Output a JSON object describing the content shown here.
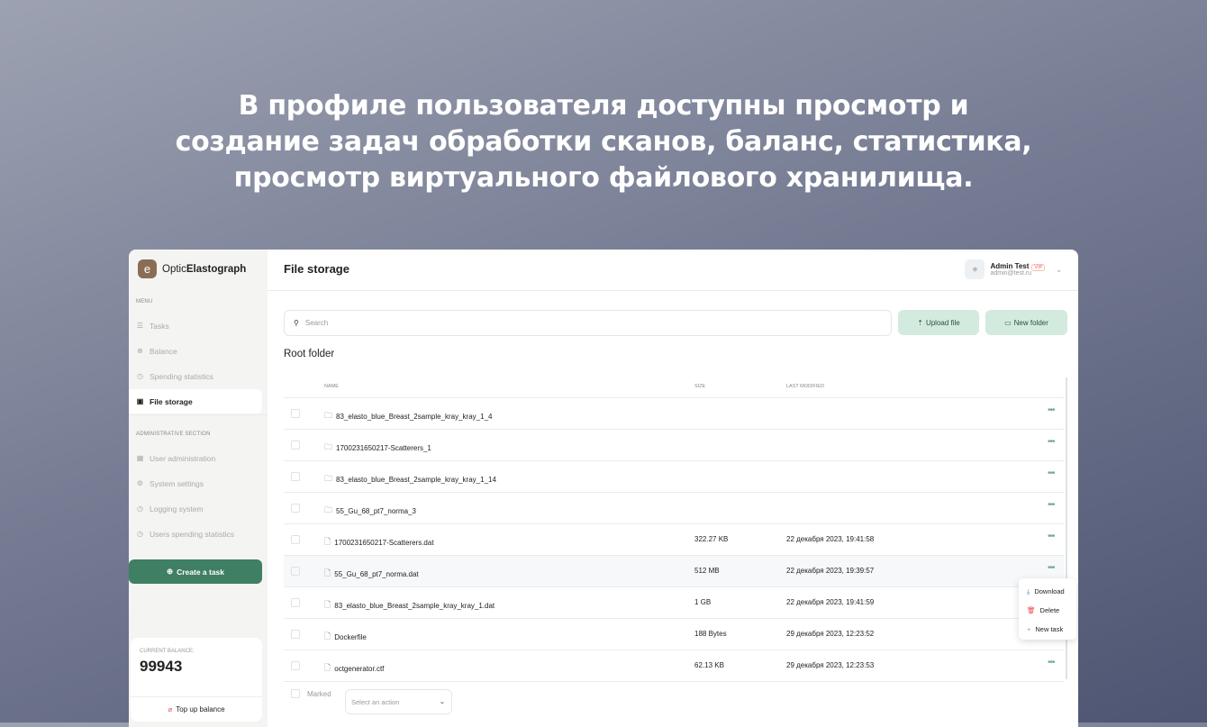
{
  "headline": [
    "В профиле пользователя доступны просмотр и",
    "создание задач обработки сканов, баланс, статистика,",
    "просмотр виртуального файлового хранилища."
  ],
  "app": {
    "logo_letter": "e",
    "name_light": "Optic",
    "name_bold": "Elastograph"
  },
  "sidebar": {
    "menu_label": "MENU",
    "items": [
      {
        "label": "Tasks",
        "icon": "☰"
      },
      {
        "label": "Balance",
        "icon": "⊗"
      },
      {
        "label": "Spending statistics",
        "icon": "◷"
      },
      {
        "label": "File storage",
        "icon": "▣"
      }
    ],
    "admin_label": "ADMINISTRATIVE SECTION",
    "admin_items": [
      {
        "label": "User administration",
        "icon": "▦"
      },
      {
        "label": "System settings",
        "icon": "⚙"
      },
      {
        "label": "Logging system",
        "icon": "◷"
      },
      {
        "label": "Users spending statistics",
        "icon": "◷"
      }
    ],
    "create_task": "Create a task",
    "balance_label": "CURRENT BALANCE:",
    "balance": "99943",
    "top_up": "Top up balance"
  },
  "header": {
    "title": "File storage",
    "user_name": "Admin Test",
    "badge": "VIP",
    "email": "admin@test.ru"
  },
  "toolbar": {
    "search_placeholder": "Search",
    "upload": "Upload file",
    "new_folder": "New folder"
  },
  "folder_title": "Root folder",
  "table": {
    "columns": [
      "NAME",
      "SIZE",
      "LAST MODIFIED"
    ],
    "rows": [
      {
        "type": "folder",
        "name": "83_elasto_blue_Breast_2sample_kray_kray_1_4",
        "size": "",
        "modified": ""
      },
      {
        "type": "folder",
        "name": "1700231650217-Scatterers_1",
        "size": "",
        "modified": ""
      },
      {
        "type": "folder",
        "name": "83_elasto_blue_Breast_2sample_kray_kray_1_14",
        "size": "",
        "modified": ""
      },
      {
        "type": "folder",
        "name": "55_Gu_68_pt7_norma_3",
        "size": "",
        "modified": ""
      },
      {
        "type": "file",
        "name": "1700231650217-Scatterers.dat",
        "size": "322.27 KB",
        "modified": "22 декабря 2023, 19:41:58"
      },
      {
        "type": "file",
        "name": "55_Gu_68_pt7_norma.dat",
        "size": "512 MB",
        "modified": "22 декабря 2023, 19:39:57"
      },
      {
        "type": "file",
        "name": "83_elasto_blue_Breast_2sample_kray_kray_1.dat",
        "size": "1 GB",
        "modified": "22 декабря 2023, 19:41:59"
      },
      {
        "type": "file",
        "name": "Dockerfile",
        "size": "188 Bytes",
        "modified": "29 декабря 2023, 12:23:52"
      },
      {
        "type": "file",
        "name": "octgenerator.ctf",
        "size": "62.13 KB",
        "modified": "29 декабря 2023, 12:23:53"
      }
    ]
  },
  "context_menu": [
    "Download",
    "Delete",
    "New task"
  ],
  "footer": {
    "marked": "Marked",
    "action_placeholder": "Select an action"
  }
}
